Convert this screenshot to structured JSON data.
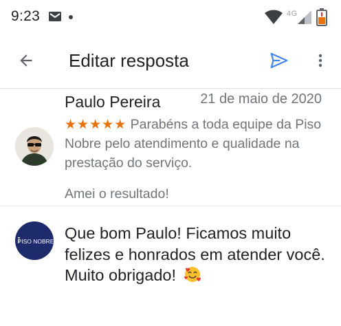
{
  "status_bar": {
    "time": "9:23",
    "network": "4G",
    "icons": [
      "gmail-icon",
      "notification-dot-icon",
      "wifi-icon",
      "signal-icon",
      "battery-icon"
    ]
  },
  "app_bar": {
    "back_icon": "arrow-back-icon",
    "title": "Editar resposta",
    "send_icon": "send-icon",
    "more_icon": "more-vert-icon"
  },
  "review": {
    "author": "Paulo Pereira",
    "date": "21 de maio de 2020",
    "stars_text": "★★★★★",
    "rating": 5,
    "text": "Parabéns a toda equipe da Piso Nobre pelo atendimento e qualidade na prestação do serviço.",
    "footer": "Amei o resultado!"
  },
  "reply": {
    "logo_text": "PISO NOBRE",
    "text": "Que bom Paulo! Ficamos muito felizes e honrados em atender você. Muito obrigado!",
    "emoji_icon": "smiling-face-with-hearts-icon"
  },
  "colors": {
    "accent": "#4285f4",
    "star": "#e8710a",
    "primary_text": "#202124",
    "secondary_text": "#70757a",
    "logo_bg": "#1d2a6b"
  }
}
